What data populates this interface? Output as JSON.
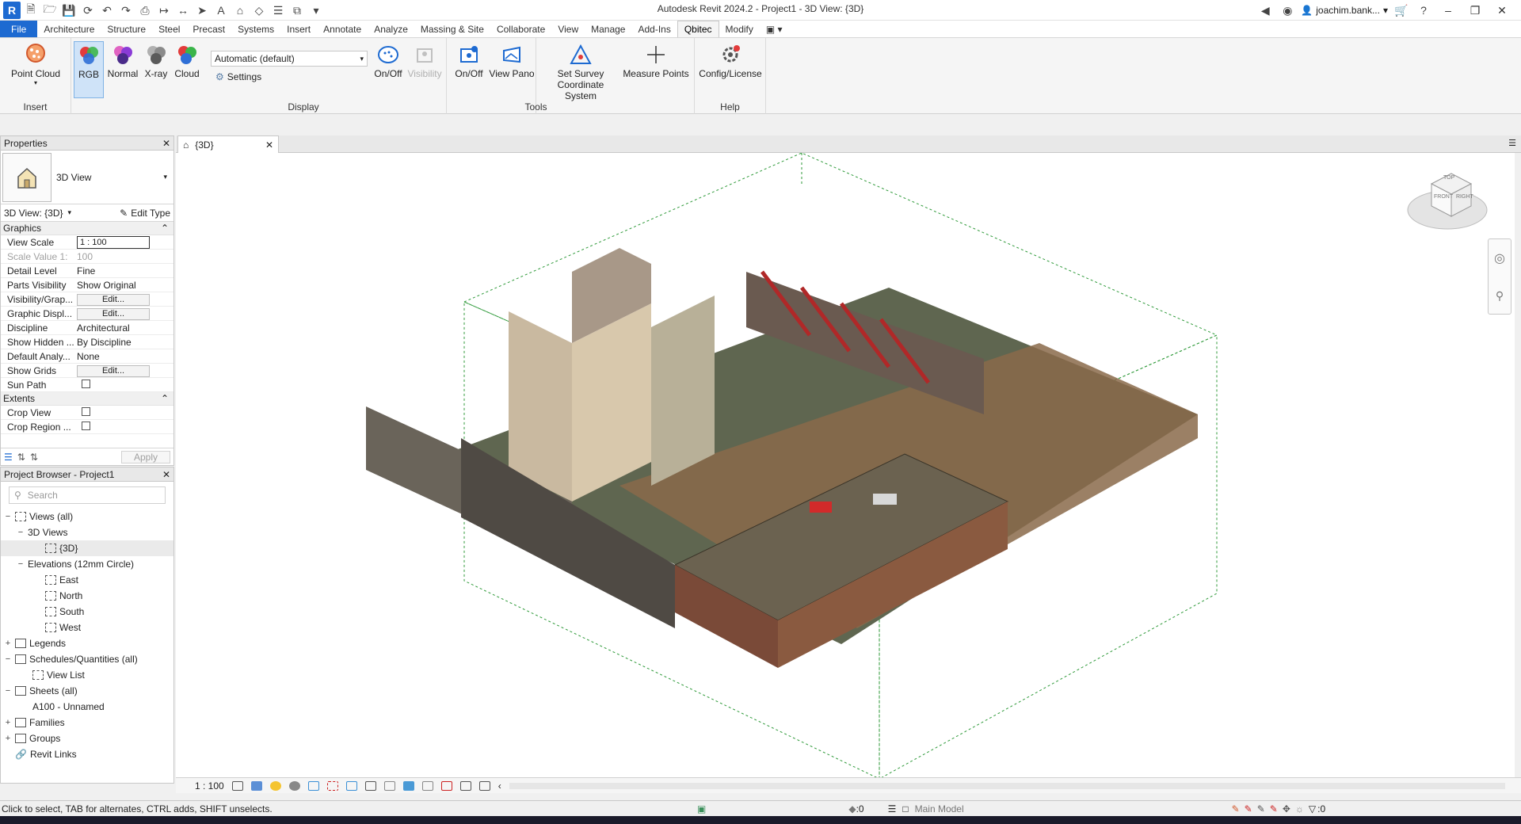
{
  "window": {
    "title": "Autodesk Revit 2024.2 - Project1 - 3D View: {3D}",
    "user": "joachim.bank...",
    "app_icon": "R"
  },
  "tabs": [
    "File",
    "Architecture",
    "Structure",
    "Steel",
    "Precast",
    "Systems",
    "Insert",
    "Annotate",
    "Analyze",
    "Massing & Site",
    "Collaborate",
    "View",
    "Manage",
    "Add-Ins",
    "Qbitec",
    "Modify"
  ],
  "active_tab": "Qbitec",
  "ribbon": {
    "insert": {
      "label": "Insert",
      "point_cloud": "Point Cloud"
    },
    "display": {
      "label": "Display",
      "rgb": "RGB",
      "normal": "Normal",
      "xray": "X-ray",
      "cloud": "Cloud",
      "dropdown_value": "Automatic (default)",
      "settings": "Settings",
      "onoff": "On/Off",
      "visibility": "Visibility"
    },
    "tools": {
      "label": "Tools",
      "onoff": "On/Off",
      "view_pano": "View Pano",
      "set_survey_1": "Set Survey",
      "set_survey_2": "Coordinate System",
      "measure_points": "Measure Points"
    },
    "help": {
      "label": "Help",
      "config": "Config/License"
    }
  },
  "properties": {
    "title": "Properties",
    "type_name": "3D View",
    "instance_selector": "3D View: {3D}",
    "edit_type": "Edit Type",
    "graphics_group": "Graphics",
    "rows": [
      {
        "key": "View Scale",
        "value": "1 : 100"
      },
      {
        "key": "Scale Value    1:",
        "value": "100"
      },
      {
        "key": "Detail Level",
        "value": "Fine"
      },
      {
        "key": "Parts Visibility",
        "value": "Show Original"
      },
      {
        "key": "Visibility/Grap...",
        "value": "Edit..."
      },
      {
        "key": "Graphic Displ...",
        "value": "Edit..."
      },
      {
        "key": "Discipline",
        "value": "Architectural"
      },
      {
        "key": "Show Hidden ...",
        "value": "By Discipline"
      },
      {
        "key": "Default Analy...",
        "value": "None"
      },
      {
        "key": "Show Grids",
        "value": "Edit..."
      },
      {
        "key": "Sun Path",
        "value": ""
      }
    ],
    "extents_group": "Extents",
    "extents_rows": [
      {
        "key": "Crop View",
        "value": ""
      },
      {
        "key": "Crop Region ...",
        "value": ""
      }
    ],
    "apply": "Apply"
  },
  "browser": {
    "title": "Project Browser - Project1",
    "search_placeholder": "Search",
    "nodes": [
      {
        "label": "Views (all)"
      },
      {
        "label": "3D Views"
      },
      {
        "label": "{3D}"
      },
      {
        "label": "Elevations (12mm Circle)"
      },
      {
        "label": "East"
      },
      {
        "label": "North"
      },
      {
        "label": "South"
      },
      {
        "label": "West"
      },
      {
        "label": "Legends"
      },
      {
        "label": "Schedules/Quantities (all)"
      },
      {
        "label": "View List"
      },
      {
        "label": "Sheets (all)"
      },
      {
        "label": "A100 - Unnamed"
      },
      {
        "label": "Families"
      },
      {
        "label": "Groups"
      },
      {
        "label": "Revit Links"
      }
    ]
  },
  "view": {
    "tab_label": "{3D}",
    "scale": "1 : 100",
    "viewcube": {
      "top": "TOP",
      "front": "FRONT",
      "right": "RIGHT"
    }
  },
  "status": {
    "message": "Click to select, TAB for alternates, CTRL adds, SHIFT unselects.",
    "worksets": ":0",
    "model": "Main Model",
    "filter": ":0"
  }
}
